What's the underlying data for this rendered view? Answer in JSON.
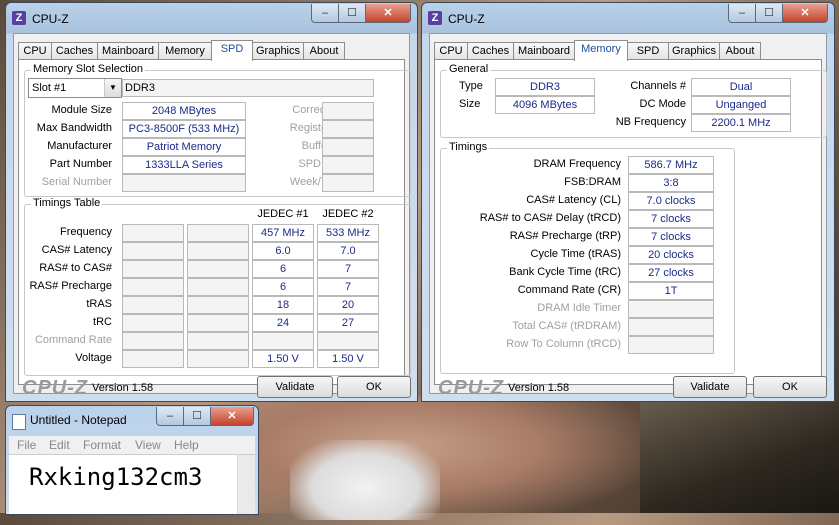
{
  "left": {
    "title": "CPU-Z",
    "tabs": [
      "CPU",
      "Caches",
      "Mainboard",
      "Memory",
      "SPD",
      "Graphics",
      "About"
    ],
    "active_tab": "SPD",
    "slot_group": "Memory Slot Selection",
    "slot_value": "Slot #1",
    "slot_type": "DDR3",
    "module_size_label": "Module Size",
    "module_size": "2048 MBytes",
    "max_bw_label": "Max Bandwidth",
    "max_bw": "PC3-8500F (533 MHz)",
    "manufacturer_label": "Manufacturer",
    "manufacturer": "Patriot Memory",
    "part_label": "Part Number",
    "part": "1333LLA Series",
    "serial_label": "Serial Number",
    "correction_label": "Correction",
    "registered_label": "Registered",
    "buffered_label": "Buffered",
    "spd_ext_label": "SPD Ext.",
    "week_year_label": "Week/Year",
    "timings_group": "Timings Table",
    "jedec1": "JEDEC #1",
    "jedec2": "JEDEC #2",
    "rows": [
      {
        "label": "Frequency",
        "j1": "457 MHz",
        "j2": "533 MHz",
        "disabled": false
      },
      {
        "label": "CAS# Latency",
        "j1": "6.0",
        "j2": "7.0",
        "disabled": false
      },
      {
        "label": "RAS# to CAS#",
        "j1": "6",
        "j2": "7",
        "disabled": false
      },
      {
        "label": "RAS# Precharge",
        "j1": "6",
        "j2": "7",
        "disabled": false
      },
      {
        "label": "tRAS",
        "j1": "18",
        "j2": "20",
        "disabled": false
      },
      {
        "label": "tRC",
        "j1": "24",
        "j2": "27",
        "disabled": false
      },
      {
        "label": "Command Rate",
        "j1": "",
        "j2": "",
        "disabled": true
      },
      {
        "label": "Voltage",
        "j1": "1.50 V",
        "j2": "1.50 V",
        "disabled": false
      }
    ],
    "logo": "CPU-Z",
    "version": "Version 1.58",
    "validate": "Validate",
    "ok": "OK"
  },
  "right": {
    "title": "CPU-Z",
    "tabs": [
      "CPU",
      "Caches",
      "Mainboard",
      "Memory",
      "SPD",
      "Graphics",
      "About"
    ],
    "active_tab": "Memory",
    "general_group": "General",
    "type_label": "Type",
    "type": "DDR3",
    "size_label": "Size",
    "size": "4096 MBytes",
    "channels_label": "Channels #",
    "channels": "Dual",
    "dcmode_label": "DC Mode",
    "dcmode": "Unganged",
    "nbfreq_label": "NB Frequency",
    "nbfreq": "2200.1 MHz",
    "timings_group": "Timings",
    "rows": [
      {
        "label": "DRAM Frequency",
        "value": "586.7 MHz",
        "disabled": false
      },
      {
        "label": "FSB:DRAM",
        "value": "3:8",
        "disabled": false
      },
      {
        "label": "CAS# Latency (CL)",
        "value": "7.0 clocks",
        "disabled": false
      },
      {
        "label": "RAS# to CAS# Delay (tRCD)",
        "value": "7 clocks",
        "disabled": false
      },
      {
        "label": "RAS# Precharge (tRP)",
        "value": "7 clocks",
        "disabled": false
      },
      {
        "label": "Cycle Time (tRAS)",
        "value": "20 clocks",
        "disabled": false
      },
      {
        "label": "Bank Cycle Time (tRC)",
        "value": "27 clocks",
        "disabled": false
      },
      {
        "label": "Command Rate (CR)",
        "value": "1T",
        "disabled": false
      },
      {
        "label": "DRAM Idle Timer",
        "value": "",
        "disabled": true
      },
      {
        "label": "Total CAS# (tRDRAM)",
        "value": "",
        "disabled": true
      },
      {
        "label": "Row To Column (tRCD)",
        "value": "",
        "disabled": true
      }
    ],
    "logo": "CPU-Z",
    "version": "Version 1.58",
    "validate": "Validate",
    "ok": "OK"
  },
  "notepad": {
    "title": "Untitled - Notepad",
    "menu": [
      "File",
      "Edit",
      "Format",
      "View",
      "Help"
    ],
    "text": "Rxking132cm3"
  }
}
